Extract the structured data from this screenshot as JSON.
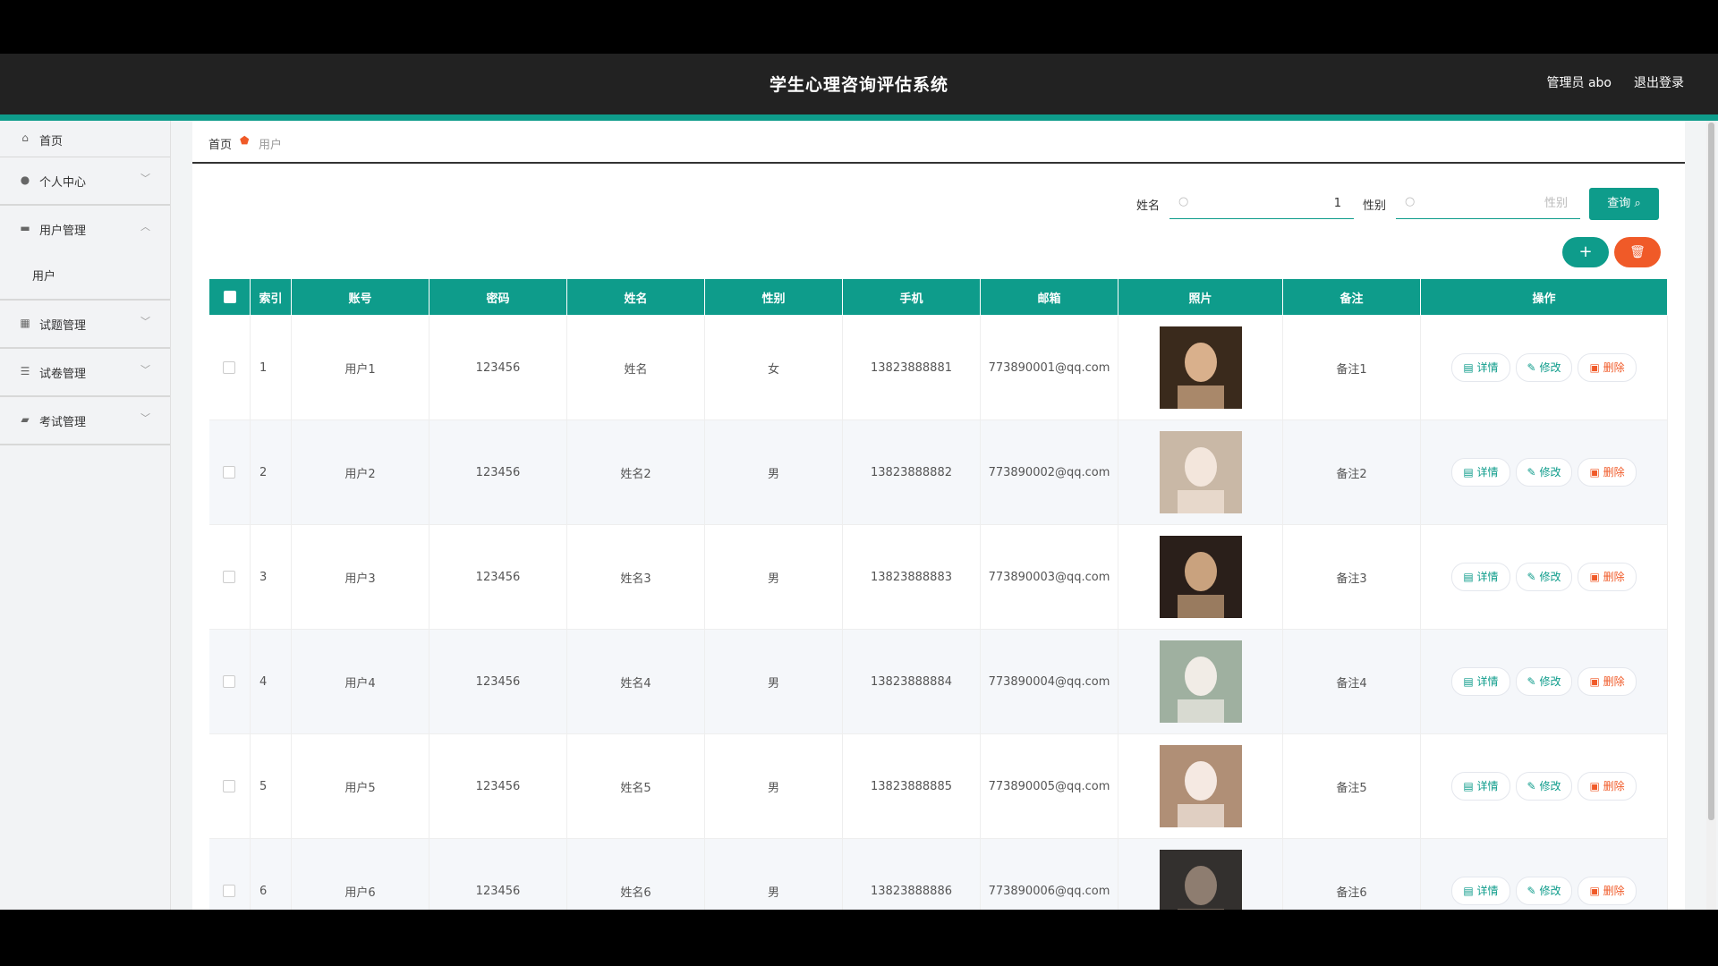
{
  "header": {
    "title": "学生心理咨询评估系统",
    "user": "管理员 abo",
    "logout": "退出登录"
  },
  "sidebar": {
    "items": [
      {
        "label": "首页",
        "icon": "home-icon"
      },
      {
        "label": "个人中心",
        "icon": "user-icon"
      },
      {
        "label": "用户管理",
        "icon": "briefcase-icon"
      },
      {
        "label": "用户",
        "icon": ""
      },
      {
        "label": "试题管理",
        "icon": "grid-icon"
      },
      {
        "label": "试卷管理",
        "icon": "list-icon"
      },
      {
        "label": "考试管理",
        "icon": "ticket-icon"
      }
    ]
  },
  "breadcrumb": {
    "home": "首页",
    "current": "用户"
  },
  "search": {
    "name_label": "姓名",
    "name_value": "1",
    "gender_label": "性别",
    "gender_placeholder": "性别",
    "query_label": "查询"
  },
  "actions": {
    "add": "+",
    "delete": "🗑"
  },
  "table": {
    "headers": [
      "索引",
      "账号",
      "密码",
      "姓名",
      "性别",
      "手机",
      "邮箱",
      "照片",
      "备注",
      "操作"
    ],
    "op_labels": {
      "detail": "详情",
      "edit": "修改",
      "delete": "删除"
    },
    "rows": [
      {
        "index": "1",
        "account": "用户1",
        "password": "123456",
        "name": "姓名",
        "gender": "女",
        "phone": "13823888881",
        "email": "773890001@qq.com",
        "note": "备注1"
      },
      {
        "index": "2",
        "account": "用户2",
        "password": "123456",
        "name": "姓名2",
        "gender": "男",
        "phone": "13823888882",
        "email": "773890002@qq.com",
        "note": "备注2"
      },
      {
        "index": "3",
        "account": "用户3",
        "password": "123456",
        "name": "姓名3",
        "gender": "男",
        "phone": "13823888883",
        "email": "773890003@qq.com",
        "note": "备注3"
      },
      {
        "index": "4",
        "account": "用户4",
        "password": "123456",
        "name": "姓名4",
        "gender": "男",
        "phone": "13823888884",
        "email": "773890004@qq.com",
        "note": "备注4"
      },
      {
        "index": "5",
        "account": "用户5",
        "password": "123456",
        "name": "姓名5",
        "gender": "男",
        "phone": "13823888885",
        "email": "773890005@qq.com",
        "note": "备注5"
      },
      {
        "index": "6",
        "account": "用户6",
        "password": "123456",
        "name": "姓名6",
        "gender": "男",
        "phone": "13823888886",
        "email": "773890006@qq.com",
        "note": "备注6"
      }
    ]
  },
  "colors": {
    "accent": "#0e9c8b",
    "danger": "#f05a28",
    "header_bg": "#222222"
  }
}
